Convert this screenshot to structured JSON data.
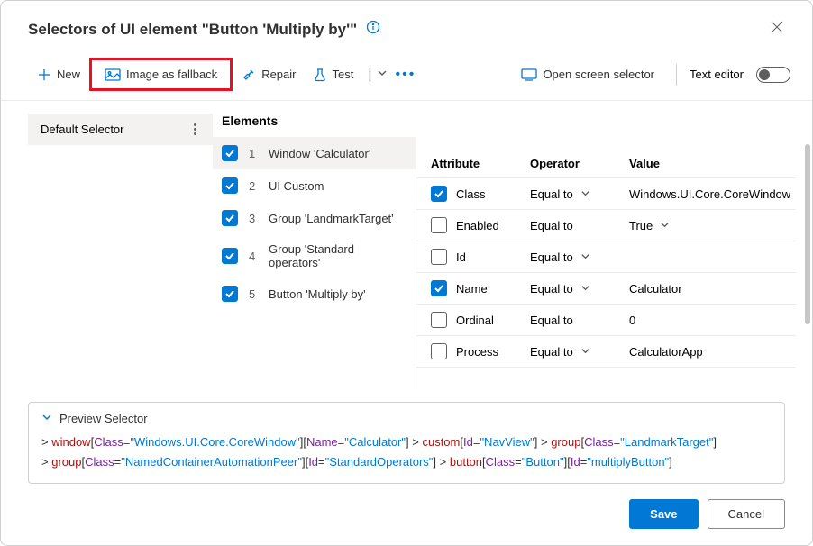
{
  "header": {
    "title": "Selectors of UI element \"Button 'Multiply by'\""
  },
  "toolbar": {
    "new": "New",
    "image_fallback": "Image as fallback",
    "repair": "Repair",
    "test": "Test",
    "open_screen": "Open screen selector",
    "text_editor": "Text editor"
  },
  "sidebar": {
    "default_selector": "Default Selector"
  },
  "elements": {
    "title": "Elements",
    "items": [
      {
        "num": "1",
        "label": "Window 'Calculator'",
        "selected": true
      },
      {
        "num": "2",
        "label": "UI Custom",
        "selected": false
      },
      {
        "num": "3",
        "label": "Group 'LandmarkTarget'",
        "selected": false
      },
      {
        "num": "4",
        "label": "Group 'Standard operators'",
        "selected": false
      },
      {
        "num": "5",
        "label": "Button 'Multiply by'",
        "selected": false
      }
    ]
  },
  "attributes": {
    "headers": {
      "attribute": "Attribute",
      "operator": "Operator",
      "value": "Value"
    },
    "rows": [
      {
        "checked": true,
        "name": "Class",
        "operator": "Equal to",
        "value": "Windows.UI.Core.CoreWindow",
        "hasOpChev": true,
        "hasValChev": false
      },
      {
        "checked": false,
        "name": "Enabled",
        "operator": "Equal to",
        "value": "True",
        "hasOpChev": false,
        "hasValChev": true
      },
      {
        "checked": false,
        "name": "Id",
        "operator": "Equal to",
        "value": "",
        "hasOpChev": true,
        "hasValChev": false
      },
      {
        "checked": true,
        "name": "Name",
        "operator": "Equal to",
        "value": "Calculator",
        "hasOpChev": true,
        "hasValChev": false
      },
      {
        "checked": false,
        "name": "Ordinal",
        "operator": "Equal to",
        "value": "0",
        "hasOpChev": false,
        "hasValChev": false
      },
      {
        "checked": false,
        "name": "Process",
        "operator": "Equal to",
        "value": "CalculatorApp",
        "hasOpChev": true,
        "hasValChev": false
      }
    ]
  },
  "preview": {
    "title": "Preview Selector",
    "tokens": [
      {
        "t": "gt",
        "v": "> "
      },
      {
        "t": "tag",
        "v": "window"
      },
      {
        "t": "eq",
        "v": "["
      },
      {
        "t": "attr",
        "v": "Class"
      },
      {
        "t": "eq",
        "v": "="
      },
      {
        "t": "val",
        "v": "\"Windows.UI.Core.CoreWindow\""
      },
      {
        "t": "eq",
        "v": "]"
      },
      {
        "t": "eq",
        "v": "["
      },
      {
        "t": "attr",
        "v": "Name"
      },
      {
        "t": "eq",
        "v": "="
      },
      {
        "t": "val",
        "v": "\"Calculator\""
      },
      {
        "t": "eq",
        "v": "]"
      },
      {
        "t": "gt",
        "v": " > "
      },
      {
        "t": "tag",
        "v": "custom"
      },
      {
        "t": "eq",
        "v": "["
      },
      {
        "t": "attr",
        "v": "Id"
      },
      {
        "t": "eq",
        "v": "="
      },
      {
        "t": "val",
        "v": "\"NavView\""
      },
      {
        "t": "eq",
        "v": "]"
      },
      {
        "t": "gt",
        "v": " > "
      },
      {
        "t": "tag",
        "v": "group"
      },
      {
        "t": "eq",
        "v": "["
      },
      {
        "t": "attr",
        "v": "Class"
      },
      {
        "t": "eq",
        "v": "="
      },
      {
        "t": "val",
        "v": "\"LandmarkTarget\""
      },
      {
        "t": "eq",
        "v": "]"
      },
      {
        "t": "br"
      },
      {
        "t": "gt",
        "v": "> "
      },
      {
        "t": "tag",
        "v": "group"
      },
      {
        "t": "eq",
        "v": "["
      },
      {
        "t": "attr",
        "v": "Class"
      },
      {
        "t": "eq",
        "v": "="
      },
      {
        "t": "val",
        "v": "\"NamedContainerAutomationPeer\""
      },
      {
        "t": "eq",
        "v": "]"
      },
      {
        "t": "eq",
        "v": "["
      },
      {
        "t": "attr",
        "v": "Id"
      },
      {
        "t": "eq",
        "v": "="
      },
      {
        "t": "val",
        "v": "\"StandardOperators\""
      },
      {
        "t": "eq",
        "v": "]"
      },
      {
        "t": "gt",
        "v": " > "
      },
      {
        "t": "tag",
        "v": "button"
      },
      {
        "t": "eq",
        "v": "["
      },
      {
        "t": "attr",
        "v": "Class"
      },
      {
        "t": "eq",
        "v": "="
      },
      {
        "t": "val",
        "v": "\"Button\""
      },
      {
        "t": "eq",
        "v": "]"
      },
      {
        "t": "eq",
        "v": "["
      },
      {
        "t": "attr",
        "v": "Id"
      },
      {
        "t": "eq",
        "v": "="
      },
      {
        "t": "val",
        "v": "\"multiplyButton\""
      },
      {
        "t": "eq",
        "v": "]"
      }
    ]
  },
  "footer": {
    "save": "Save",
    "cancel": "Cancel"
  }
}
